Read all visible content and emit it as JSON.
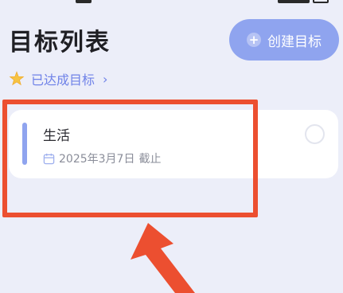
{
  "header": {
    "title": "目标列表",
    "create_button_label": "创建目标"
  },
  "achieved_link": {
    "label": "已达成目标",
    "chevron": "›",
    "icon": "star-icon"
  },
  "goals": [
    {
      "title": "生活",
      "date": "2025年3月7日",
      "deadline_label": "截止",
      "accent_color": "#8fa4ef"
    }
  ],
  "colors": {
    "accent": "#8fa4ef",
    "link": "#6f82e8",
    "background": "#eceef9",
    "annotation": "#ec4f30"
  }
}
